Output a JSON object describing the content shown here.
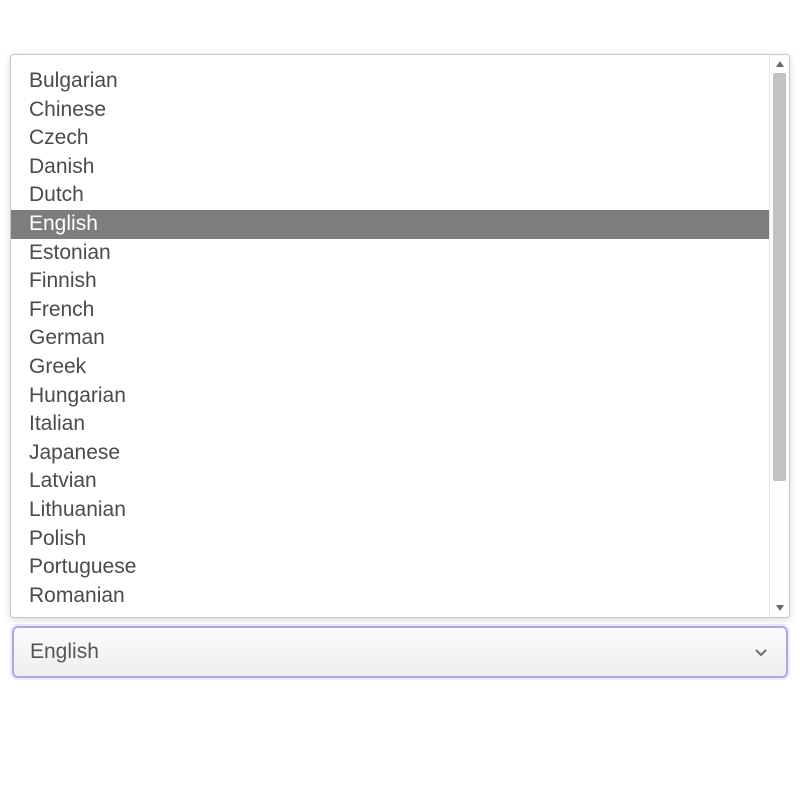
{
  "dropdown": {
    "options": [
      "Bulgarian",
      "Chinese",
      "Czech",
      "Danish",
      "Dutch",
      "English",
      "Estonian",
      "Finnish",
      "French",
      "German",
      "Greek",
      "Hungarian",
      "Italian",
      "Japanese",
      "Latvian",
      "Lithuanian",
      "Polish",
      "Portuguese",
      "Romanian"
    ],
    "selected_index": 5
  },
  "select": {
    "value": "English"
  },
  "colors": {
    "option_text": "#4a4a4f",
    "selected_bg": "#7d7d7d",
    "selected_text": "#ffffff",
    "focus_border": "#a9a9ea"
  }
}
